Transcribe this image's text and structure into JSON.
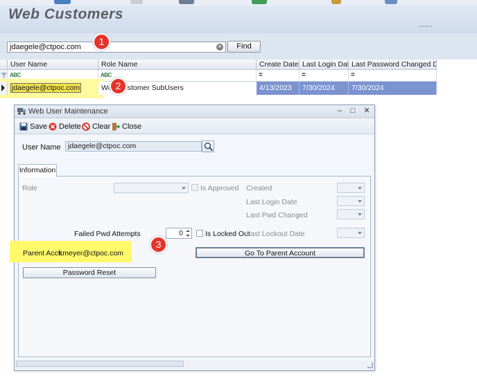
{
  "page": {
    "title": "Web Customers",
    "search": {
      "value": "jdaegele@ctpoc.com",
      "placeholder": ""
    },
    "find_label": "Find"
  },
  "grid": {
    "columns": [
      "User Name",
      "Role Name",
      "Create Date",
      "Last Login Date",
      "Last Password Changed Date"
    ],
    "filter_glyphs": {
      "text": "ABC",
      "equals": "="
    },
    "row": {
      "user_name": "jdaegele@ctpoc.com",
      "role_name": "Web Customer SubUsers",
      "create_date": "4/13/2023",
      "last_login_date": "7/30/2024",
      "last_password_changed_date": "7/30/2024"
    }
  },
  "annotations": [
    "1",
    "2",
    "3"
  ],
  "dialog": {
    "title": "Web User Maintenance",
    "window_buttons": {
      "minimize": "–",
      "maximize": "□",
      "close": "✕"
    },
    "toolbar": {
      "save": "Save",
      "delete": "Delete",
      "clear": "Clear",
      "close": "Close"
    },
    "user_name_label": "User Name",
    "user_name_value": "jdaegele@ctpoc.com",
    "tab": "Information",
    "fields": {
      "role": "Role",
      "is_approved": "Is Approved",
      "created": "Created",
      "last_login_date": "Last Login Date",
      "last_pwd_changed": "Last Pwd Changed",
      "failed_pwd_attempts": "Failed Pwd Attempts",
      "failed_pwd_attempts_value": "0",
      "is_locked_out": "Is Locked Out",
      "last_lockout_date": "Last Lockout Date",
      "parent_acct_label": "Parent Acct:",
      "parent_acct_value": "kmeyer@ctpoc.com"
    },
    "buttons": {
      "go_to_parent": "Go To Parent Account",
      "password_reset": "Password Reset"
    }
  },
  "colors": {
    "selection": "#7b93d1",
    "highlight": "#fff96b",
    "annotation": "#e6332a",
    "header_bg": "#d6e0ee"
  }
}
